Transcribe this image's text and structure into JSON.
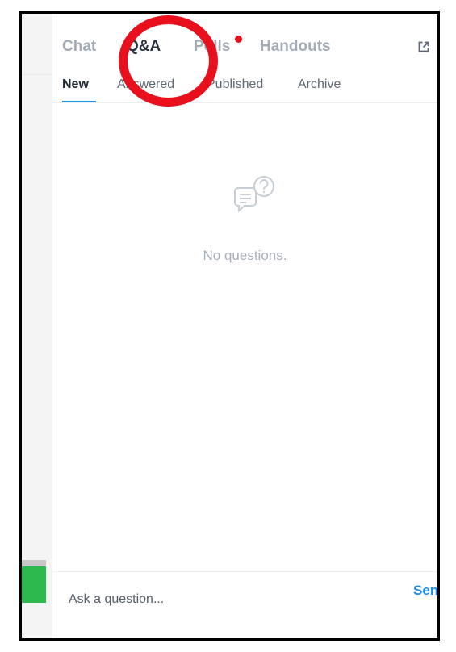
{
  "tabs": [
    {
      "label": "Chat"
    },
    {
      "label": "Q&A"
    },
    {
      "label": "Polls"
    },
    {
      "label": "Handouts"
    }
  ],
  "active_tab": "Q&A",
  "polls_notification": true,
  "subtabs": [
    {
      "label": "New"
    },
    {
      "label": "Answered"
    },
    {
      "label": "Published"
    },
    {
      "label": "Archive"
    }
  ],
  "active_subtab": "New",
  "empty_state": {
    "text": "No questions.",
    "icon": "question-chat-icon"
  },
  "composer": {
    "placeholder": "Ask a question...",
    "send_label": "Send"
  },
  "toolbar": {
    "popout_icon": "popout-icon",
    "collapse_icon": "chevron-down-icon"
  },
  "colors": {
    "accent": "#1f8ded",
    "highlight": "#e8101c",
    "notification": "#e8101c",
    "green": "#2db94d"
  }
}
